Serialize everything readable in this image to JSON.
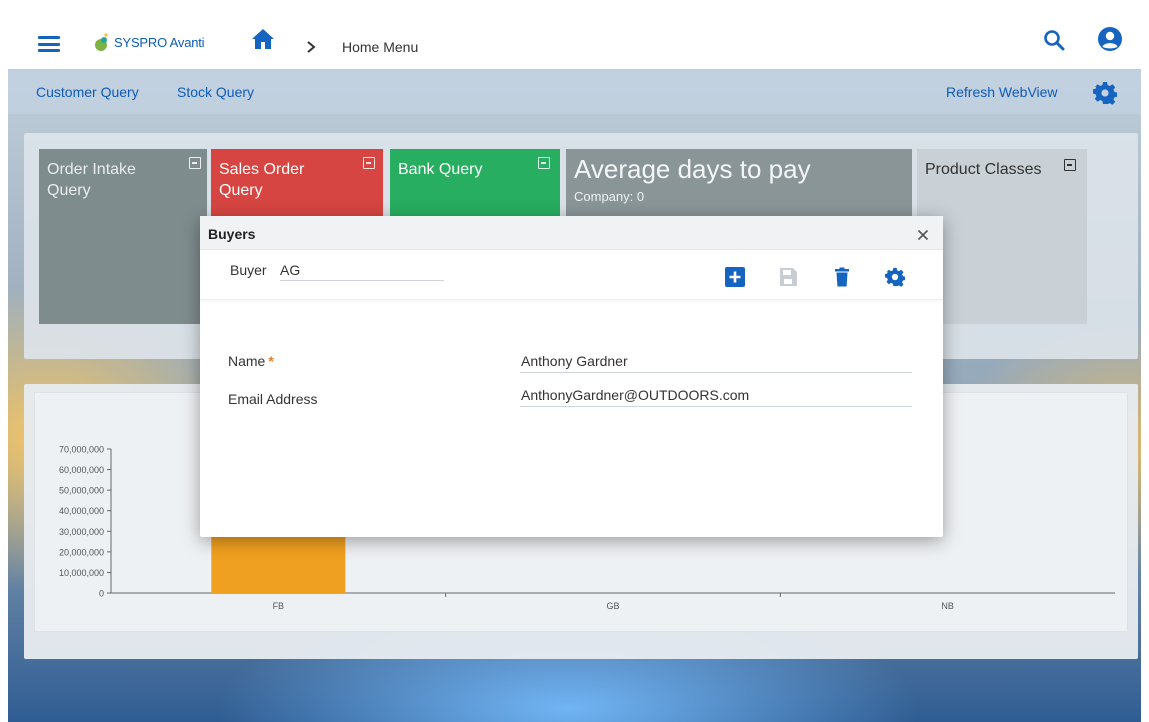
{
  "app": {
    "logo_text": "SYSPRO Avanti",
    "breadcrumb": "Home Menu"
  },
  "subnav": {
    "links": [
      "Customer Query",
      "Stock Query"
    ],
    "refresh_label": "Refresh WebView"
  },
  "tiles": [
    {
      "title": "Order Intake Query",
      "color": "#7f8c8d"
    },
    {
      "title": "Sales Order Query",
      "color": "#d64541"
    },
    {
      "title": "Bank Query",
      "color": "#27ae60"
    },
    {
      "title": "Average days to pay",
      "subtitle": "Company: 0",
      "color": "#8a9598"
    },
    {
      "title": "Product Classes",
      "color": "#c9d1d6"
    }
  ],
  "dialog": {
    "title": "Buyers",
    "key_label": "Buyer",
    "key_value": "AG",
    "fields": [
      {
        "label": "Name",
        "required": true,
        "value": "Anthony Gardner"
      },
      {
        "label": "Email Address",
        "required": false,
        "value": "AnthonyGardner@OUTDOORS.com"
      }
    ],
    "toolbar_icons": [
      "add-icon",
      "save-icon",
      "delete-icon",
      "gear-icon"
    ]
  },
  "chart_data": {
    "type": "bar",
    "categories": [
      "FB",
      "GB",
      "NB"
    ],
    "values": [
      60000000,
      0,
      0
    ],
    "ylim": [
      0,
      70000000
    ],
    "y_ticks": [
      "0",
      "10,000,000",
      "20,000,000",
      "30,000,000",
      "40,000,000",
      "50,000,000",
      "60,000,000",
      "70,000,000"
    ],
    "bar_color": "#f0a020"
  },
  "colors": {
    "accent": "#1565c0",
    "link": "#0d5db8"
  }
}
